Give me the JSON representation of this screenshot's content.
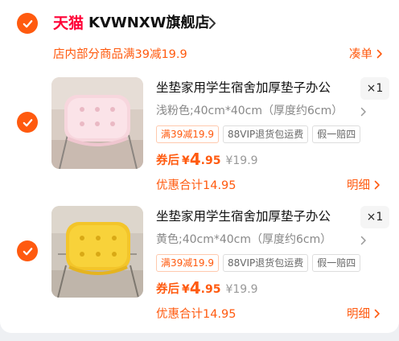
{
  "colors": {
    "accent": "#ff5a0f",
    "tmall": "#ff0036",
    "muted": "#888888"
  },
  "store": {
    "logo": "天猫",
    "name": "KVWNXW旗舰店",
    "checked": true
  },
  "promo": {
    "text": "店内部分商品满39减19.9",
    "link_label": "凑单"
  },
  "items": [
    {
      "checked": true,
      "image": "pink-seat-cushion",
      "title": "坐垫家用学生宿舍加厚垫子办公",
      "quantity": "×1",
      "sku": "浅粉色;40cm*40cm（厚度约6cm）",
      "tags": [
        "满39减19.9",
        "88VIP退货包运费",
        "假一赔四"
      ],
      "price_label": "券后",
      "currency": "¥",
      "price_int": "4",
      "price_dec": ".95",
      "original_price": "¥19.9",
      "discount_text": "优惠合计14.95",
      "detail_label": "明细"
    },
    {
      "checked": true,
      "image": "yellow-seat-cushion",
      "title": "坐垫家用学生宿舍加厚垫子办公",
      "quantity": "×1",
      "sku": "黄色;40cm*40cm（厚度约6cm）",
      "tags": [
        "满39减19.9",
        "88VIP退货包运费",
        "假一赔四"
      ],
      "price_label": "券后",
      "currency": "¥",
      "price_int": "4",
      "price_dec": ".95",
      "original_price": "¥19.9",
      "discount_text": "优惠合计14.95",
      "detail_label": "明细"
    }
  ]
}
